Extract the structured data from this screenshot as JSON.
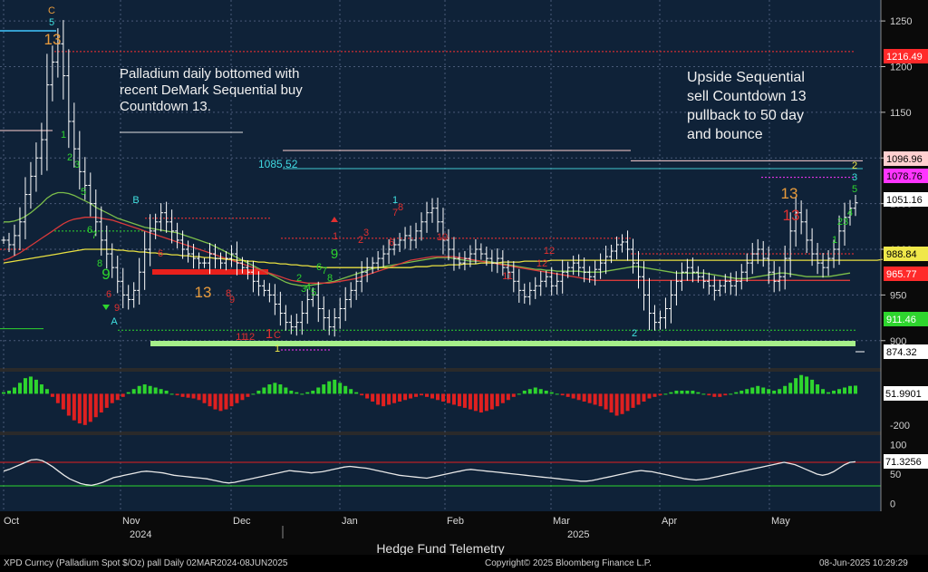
{
  "chart_data": [
    {
      "type": "candlestick",
      "title": "",
      "x_labels": [
        "Oct",
        "Nov",
        "Dec",
        "Jan",
        "Feb",
        "Mar",
        "Apr",
        "May"
      ],
      "year_labels": [
        "2024",
        "2025"
      ],
      "y_ticks": [
        900,
        950,
        1000,
        1050,
        1100,
        1150,
        1200,
        1250
      ],
      "ylim": [
        870,
        1265
      ],
      "grid": true,
      "price_tags": [
        {
          "label": "1216.49",
          "value": 1216.49,
          "color": "#ff2a2a"
        },
        {
          "label": "1096.96",
          "value": 1096.96,
          "color": "#ffd0d0"
        },
        {
          "label": "1078.76",
          "value": 1078.76,
          "color": "#ff35ff"
        },
        {
          "label": "1051.16",
          "value": 1051.16,
          "color": "#ffffff"
        },
        {
          "label": "988.84",
          "value": 988.84,
          "color": "#f0e84a"
        },
        {
          "label": "965.77",
          "value": 965.77,
          "color": "#ff2a2a"
        },
        {
          "label": "911.46",
          "value": 911.46,
          "color": "#2ed52e"
        },
        {
          "label": "874.32",
          "value": 874.32,
          "color": "#ffffff"
        }
      ],
      "level_label": "1085.52",
      "annotations": [
        "Palladium daily bottomed with",
        "recent DeMark Sequential buy",
        "Countdown 13.",
        "Upside Sequential",
        "sell Countdown 13",
        "pullback to 50 day",
        "and bounce"
      ],
      "demark_labels": {
        "orange": [
          "C",
          "13",
          "13",
          "13",
          "2"
        ],
        "cyan": [
          "5",
          "B",
          "A",
          "1",
          "3",
          "2"
        ],
        "green": [
          "1",
          "2",
          "3",
          "5",
          "6",
          "7",
          "8",
          "9",
          "2",
          "3",
          "4",
          "5",
          "6",
          "7",
          "8",
          "9",
          "1",
          "23",
          "4",
          "5",
          "1"
        ],
        "red": [
          "6",
          "8",
          "9",
          "11",
          "12",
          "1",
          "C",
          "1",
          "2",
          "3",
          "4",
          "5",
          "6",
          "7",
          "8",
          "10",
          "11",
          "12",
          "13"
        ],
        "yellow": [
          "1"
        ]
      },
      "series": [
        {
          "name": "",
          "kind": "close",
          "values": [
            1010,
            1005,
            1015,
            1030,
            1060,
            1080,
            1100,
            1120,
            1180,
            1205,
            1225,
            1190,
            1140,
            1110,
            1085,
            1070,
            1050,
            1030,
            1010,
            995,
            980,
            965,
            950,
            945,
            955,
            975,
            1000,
            1020,
            1030,
            1040,
            1030,
            1020,
            1010,
            1000,
            995,
            990,
            985,
            985,
            995,
            990,
            985,
            990,
            995,
            985,
            980,
            975,
            965,
            960,
            955,
            950,
            940,
            930,
            920,
            915,
            920,
            930,
            945,
            950,
            935,
            925,
            915,
            925,
            935,
            945,
            955,
            965,
            975,
            980,
            985,
            990,
            995,
            1000,
            1005,
            1010,
            1015,
            1010,
            1020,
            1030,
            1040,
            1045,
            1030,
            1010,
            1000,
            990,
            985,
            990,
            995,
            1000,
            995,
            990,
            985,
            990,
            980,
            975,
            965,
            955,
            948,
            955,
            960,
            965,
            970,
            960,
            965,
            975,
            980,
            985,
            980,
            975,
            970,
            978,
            985,
            992,
            998,
            1005,
            1008,
            1000,
            985,
            970,
            950,
            930,
            920,
            925,
            935,
            950,
            965,
            975,
            980,
            975,
            970,
            965,
            960,
            955,
            960,
            965,
            960,
            965,
            975,
            985,
            995,
            1000,
            990,
            975,
            965,
            970,
            990,
            1020,
            1040,
            1030,
            1010,
            995,
            985,
            980,
            990,
            1000,
            1020,
            1035,
            1045,
            1051
          ]
        },
        {
          "name": "",
          "kind": "ma50",
          "values": [
            1030,
            1030,
            1031,
            1033,
            1036,
            1040,
            1045,
            1050,
            1056,
            1060,
            1062,
            1062,
            1061,
            1059,
            1056,
            1053,
            1050,
            1046,
            1043,
            1040,
            1037,
            1034,
            1032,
            1030,
            1028,
            1026,
            1024,
            1023,
            1022,
            1021,
            1020,
            1019,
            1018,
            1016,
            1014,
            1012,
            1010,
            1008,
            1006,
            1003,
            1000,
            997,
            994,
            991,
            988,
            985,
            982,
            979,
            976,
            973,
            970,
            967,
            964,
            962,
            961,
            960,
            960,
            961,
            962,
            963,
            964,
            965,
            967,
            969,
            971,
            973,
            975,
            977,
            979,
            980,
            981,
            982,
            983,
            984,
            985,
            986,
            987,
            988,
            989,
            990,
            991,
            991,
            991,
            990,
            989,
            988,
            987,
            987,
            987,
            987,
            986,
            985,
            984,
            983,
            982,
            981,
            980,
            979,
            978,
            978,
            977,
            977,
            976,
            976,
            976,
            976,
            976,
            975,
            975,
            975,
            975,
            976,
            977,
            978,
            979,
            980,
            981,
            981,
            980,
            979,
            978,
            977,
            976,
            975,
            974,
            974,
            974,
            974,
            974,
            974,
            973,
            972,
            971,
            970,
            969,
            968,
            968,
            968,
            969,
            970,
            971,
            972,
            973,
            974,
            974,
            973,
            972,
            971,
            970,
            970,
            970,
            970,
            970,
            971,
            972,
            973,
            974
          ]
        },
        {
          "name": "",
          "kind": "ma100",
          "values": [
            988,
            990,
            993,
            996,
            1000,
            1004,
            1008,
            1012,
            1016,
            1020,
            1024,
            1028,
            1031,
            1033,
            1034,
            1035,
            1035,
            1035,
            1034,
            1033,
            1032,
            1030,
            1028,
            1026,
            1024,
            1022,
            1020,
            1018,
            1016,
            1014,
            1012,
            1010,
            1008,
            1006,
            1004,
            1002,
            1000,
            998,
            996,
            994,
            992,
            990,
            988,
            986,
            984,
            982,
            980,
            978,
            976,
            974,
            972,
            970,
            968,
            966,
            965,
            964,
            963,
            963,
            963,
            963,
            963,
            964,
            965,
            966,
            967,
            968,
            970,
            972,
            974,
            976,
            978,
            980,
            982,
            984,
            986,
            988,
            989,
            990,
            991,
            992,
            992,
            992,
            992,
            992,
            991,
            990,
            989,
            988,
            987,
            986,
            985,
            984,
            983,
            982,
            981,
            980,
            979,
            978,
            977,
            976,
            975,
            974,
            973,
            972,
            971,
            970,
            969,
            968,
            967,
            966,
            966,
            966,
            966,
            966,
            966,
            966,
            966,
            966,
            966,
            966,
            966,
            966,
            966,
            966,
            966,
            966,
            966,
            966,
            966,
            966,
            966,
            966,
            966,
            966,
            966,
            966,
            966,
            966,
            966,
            966,
            966,
            966,
            966,
            966,
            966,
            966,
            966,
            966,
            966,
            966,
            966,
            966,
            966,
            966,
            966,
            966,
            966
          ]
        },
        {
          "name": "",
          "kind": "ma200",
          "values": [
            985,
            986,
            987,
            988,
            989,
            990,
            991,
            992,
            993,
            994,
            995,
            996,
            997,
            998,
            999,
            1000,
            1000,
            1000,
            1000,
            1000,
            1000,
            999,
            999,
            998,
            998,
            997,
            997,
            996,
            996,
            995,
            995,
            994,
            994,
            993,
            993,
            992,
            992,
            991,
            991,
            990,
            990,
            989,
            989,
            988,
            988,
            987,
            987,
            986,
            986,
            985,
            985,
            984,
            984,
            983,
            983,
            982,
            982,
            981,
            981,
            980,
            980,
            980,
            980,
            980,
            980,
            980,
            980,
            980,
            980,
            980,
            980,
            980,
            980,
            980,
            980,
            980,
            981,
            981,
            981,
            982,
            982,
            982,
            983,
            983,
            983,
            984,
            984,
            984,
            985,
            985,
            985,
            985,
            986,
            986,
            986,
            986,
            987,
            987,
            987,
            987,
            987,
            988,
            988,
            988,
            988,
            988,
            988,
            988,
            988,
            988,
            988,
            988,
            988,
            988,
            988,
            988,
            988,
            988,
            988,
            988,
            988,
            988,
            988,
            988,
            988,
            988,
            988,
            988,
            988,
            988,
            988,
            988,
            988,
            988,
            988,
            988,
            988,
            988,
            988,
            988,
            988,
            988,
            988,
            988,
            988,
            988,
            988,
            988,
            988,
            988,
            988,
            988,
            988,
            988,
            988,
            988,
            988,
            988,
            988,
            988,
            988,
            988,
            989
          ]
        }
      ]
    },
    {
      "type": "bar",
      "name": "oscillator",
      "tick_labels": [
        "0",
        "-200"
      ],
      "ylim": [
        -230,
        130
      ],
      "current_label": "51.9901",
      "values": [
        10,
        20,
        40,
        70,
        100,
        110,
        90,
        60,
        30,
        -20,
        -60,
        -100,
        -140,
        -170,
        -190,
        -200,
        -180,
        -150,
        -120,
        -90,
        -60,
        -40,
        -20,
        10,
        30,
        50,
        60,
        50,
        40,
        30,
        20,
        0,
        -10,
        -20,
        -25,
        -30,
        -40,
        -60,
        -80,
        -100,
        -110,
        -100,
        -80,
        -60,
        -40,
        -20,
        0,
        20,
        40,
        60,
        70,
        60,
        40,
        20,
        10,
        0,
        10,
        20,
        40,
        60,
        80,
        90,
        70,
        50,
        30,
        10,
        -10,
        -30,
        -50,
        -70,
        -80,
        -70,
        -60,
        -50,
        -40,
        -30,
        -20,
        -10,
        -20,
        -30,
        -40,
        -50,
        -60,
        -70,
        -80,
        -90,
        -100,
        -110,
        -120,
        -110,
        -100,
        -80,
        -60,
        -40,
        -20,
        0,
        20,
        30,
        40,
        30,
        20,
        10,
        0,
        -10,
        -20,
        -30,
        -40,
        -50,
        -60,
        -70,
        -80,
        -100,
        -120,
        -140,
        -130,
        -110,
        -90,
        -70,
        -50,
        -30,
        -20,
        -10,
        0,
        10,
        20,
        20,
        20,
        20,
        10,
        0,
        -10,
        -20,
        -20,
        -10,
        0,
        10,
        20,
        30,
        40,
        50,
        40,
        30,
        20,
        30,
        50,
        70,
        100,
        120,
        110,
        90,
        60,
        30,
        10,
        20,
        30,
        40,
        50,
        52
      ]
    },
    {
      "type": "line",
      "name": "rsi",
      "tick_labels": [
        "100",
        "50",
        "0"
      ],
      "ylim": [
        -10,
        110
      ],
      "levels": [
        70,
        30
      ],
      "current_label": "71.3256",
      "values": [
        55,
        58,
        62,
        66,
        70,
        74,
        75,
        73,
        68,
        62,
        55,
        48,
        42,
        38,
        34,
        32,
        31,
        33,
        36,
        40,
        44,
        46,
        48,
        50,
        52,
        54,
        55,
        54,
        53,
        52,
        50,
        48,
        47,
        46,
        45,
        44,
        43,
        42,
        40,
        38,
        36,
        35,
        36,
        38,
        40,
        42,
        44,
        46,
        48,
        50,
        52,
        54,
        56,
        55,
        54,
        53,
        52,
        53,
        54,
        56,
        58,
        60,
        62,
        63,
        62,
        61,
        60,
        58,
        56,
        54,
        52,
        50,
        48,
        47,
        46,
        45,
        44,
        43,
        45,
        47,
        49,
        51,
        53,
        55,
        57,
        58,
        57,
        56,
        55,
        54,
        53,
        52,
        51,
        50,
        49,
        48,
        47,
        46,
        45,
        44,
        43,
        42,
        41,
        40,
        39,
        38,
        38,
        39,
        41,
        43,
        45,
        47,
        49,
        51,
        53,
        55,
        56,
        55,
        54,
        52,
        50,
        48,
        46,
        44,
        42,
        41,
        40,
        41,
        42,
        44,
        46,
        48,
        50,
        52,
        54,
        56,
        58,
        60,
        62,
        64,
        66,
        68,
        70,
        68,
        66,
        62,
        58,
        54,
        50,
        48,
        50,
        54,
        60,
        66,
        70,
        71
      ]
    }
  ],
  "footer": {
    "left": "XPD Curncy (Palladium Spot  $/Oz) pall  Daily 02MAR2024-08JUN2025",
    "center": "Copyright© 2025 Bloomberg Finance L.P.",
    "right": "08-Jun-2025 10:29:29",
    "brand": "Hedge Fund Telemetry"
  }
}
